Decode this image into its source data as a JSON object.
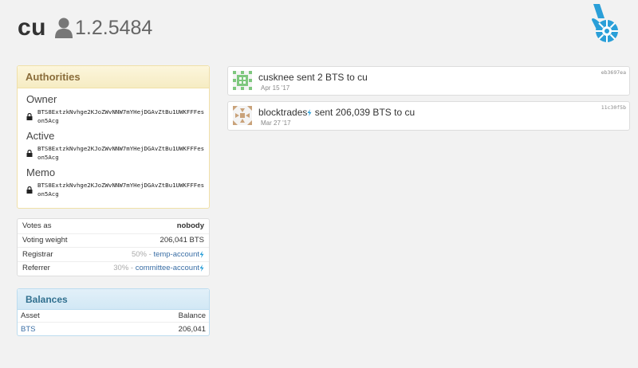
{
  "account": {
    "name": "cu",
    "id": "1.2.5484"
  },
  "icons": {
    "user": "user-icon",
    "logo": "bitshares-logo",
    "lock": "lock-icon",
    "bolt": "lightning-bolt-icon"
  },
  "authorities": {
    "title": "Authorities",
    "owner_label": "Owner",
    "owner_key": "BTS8ExtzkNvhge2KJoZWvNNW7mYHejDGAvZtBu1UWKFFFeson5Acg",
    "active_label": "Active",
    "active_key": "BTS8ExtzkNvhge2KJoZWvNNW7mYHejDGAvZtBu1UWKFFFeson5Acg",
    "memo_label": "Memo",
    "memo_key": "BTS8ExtzkNvhge2KJoZWvNNW7mYHejDGAvZtBu1UWKFFFeson5Acg"
  },
  "votes": {
    "votes_as_label": "Votes as",
    "votes_as_value": "nobody",
    "weight_label": "Voting weight",
    "weight_value": "206,041 BTS",
    "registrar_label": "Registrar",
    "registrar_pct": "50% - ",
    "registrar_account": "temp-account",
    "referrer_label": "Referrer",
    "referrer_pct": "30% - ",
    "referrer_account": "committee-account"
  },
  "balances": {
    "title": "Balances",
    "col_asset": "Asset",
    "col_balance": "Balance",
    "rows": [
      {
        "asset": "BTS",
        "balance": "206,041"
      }
    ]
  },
  "operations": [
    {
      "from": "cusknee",
      "text": " sent 2 BTS to ",
      "to": "cu",
      "date": "Apr 15 '17",
      "hash": "eb3697ea"
    },
    {
      "from": "blocktrades",
      "text": " sent 206,039 BTS to ",
      "to": "cu",
      "date": "Mar 27 '17",
      "hash": "11c30f5b"
    }
  ],
  "colors": {
    "background": "#f2f2f2",
    "link": "#3a6ea5",
    "bolt": "#2a9fd8",
    "authorities_header": "#f6ecc3",
    "balances_header": "#d2e8f5"
  }
}
